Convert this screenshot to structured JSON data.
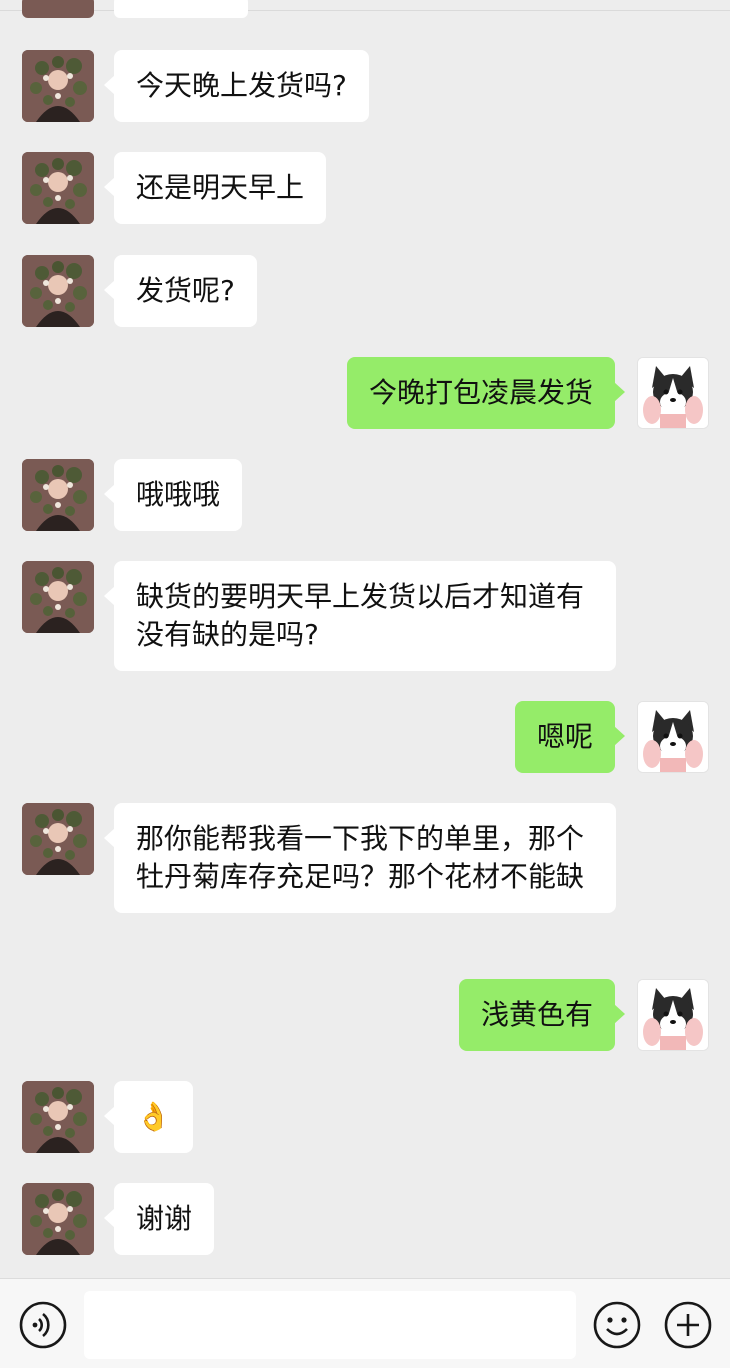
{
  "messages": [
    {
      "side": "in",
      "text": "今天晚上发货吗?"
    },
    {
      "side": "in",
      "text": "还是明天早上"
    },
    {
      "side": "in",
      "text": "发货呢?"
    },
    {
      "side": "out",
      "text": "今晚打包凌晨发货"
    },
    {
      "side": "in",
      "text": "哦哦哦"
    },
    {
      "side": "in",
      "text": "缺货的要明天早上发货以后才知道有没有缺的是吗?"
    },
    {
      "side": "out",
      "text": "嗯呢"
    },
    {
      "side": "in",
      "text": "那你能帮我看一下我下的单里，那个牡丹菊库存充足吗？那个花材不能缺"
    },
    {
      "side": "out",
      "text": "浅黄色有"
    },
    {
      "side": "in",
      "text": "👌"
    },
    {
      "side": "in",
      "text": "谢谢"
    }
  ],
  "input": {
    "value": "",
    "placeholder": ""
  },
  "icons": {
    "voice": "voice-icon",
    "emoji": "emoji-icon",
    "plus": "plus-icon",
    "contact_avatar": "avatar-woman-flowers",
    "self_avatar": "avatar-husky-dog"
  },
  "colors": {
    "background": "#ededed",
    "incoming_bubble": "#ffffff",
    "outgoing_bubble": "#95ec69",
    "text": "#111111"
  }
}
